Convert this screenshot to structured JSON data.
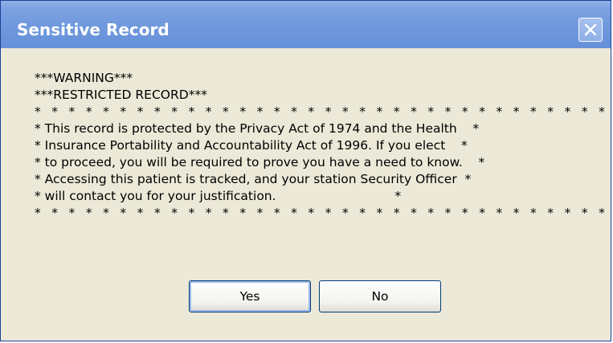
{
  "dialog": {
    "title": "Sensitive Record",
    "close_icon": "close-icon",
    "lines": [
      "***WARNING***",
      "***RESTRICTED RECORD***",
      "* * * * * * * * * * * * * * * * * * * * * * * * * * * * * * * * * * * * * * *",
      "* This record is protected by the Privacy Act of 1974 and the Health    *",
      "* Insurance Portability and Accountability Act of 1996. If you elect    *",
      "* to proceed, you will be required to prove you have a need to know.    *",
      "* Accessing this patient is tracked, and your station Security Officer  *",
      "* will contact you for your justification.                              *",
      "* * * * * * * * * * * * * * * * * * * * * * * * * * * * * * * * * * * * * * *"
    ],
    "buttons": {
      "yes_label": "Yes",
      "no_label": "No"
    }
  },
  "colors": {
    "titlebar": "#7aa0e0",
    "client_background": "#ece9d8",
    "button_border": "#003c74",
    "title_text": "#ffffff"
  }
}
